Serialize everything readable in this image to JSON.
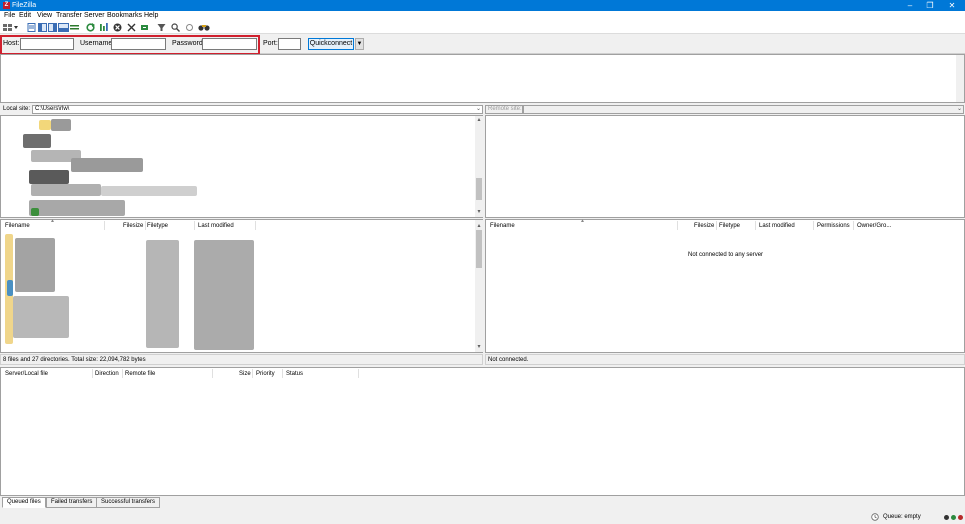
{
  "window": {
    "title": "FileZilla",
    "app_icon": "Z"
  },
  "menu": [
    "File",
    "Edit",
    "View",
    "Transfer",
    "Server",
    "Bookmarks",
    "Help"
  ],
  "quickconnect": {
    "host_label": "Host:",
    "username_label": "Username:",
    "password_label": "Password:",
    "port_label": "Port:",
    "button_label": "Quickconnect",
    "host_value": "",
    "username_value": "",
    "password_value": "",
    "port_value": ""
  },
  "local": {
    "site_label": "Local site:",
    "site_path": "C:\\Users\\rlw\\",
    "columns": [
      "Filename",
      "Filesize",
      "Filetype",
      "Last modified"
    ],
    "status": "8 files and 27 directories. Total size: 22,094,782 bytes"
  },
  "remote": {
    "site_label": "Remote site:",
    "site_path": "",
    "columns": [
      "Filename",
      "Filesize",
      "Filetype",
      "Last modified",
      "Permissions",
      "Owner/Gro..."
    ],
    "empty_message": "Not connected to any server",
    "status": "Not connected."
  },
  "queue": {
    "columns": [
      "Server/Local file",
      "Direction",
      "Remote file",
      "Size",
      "Priority",
      "Status"
    ],
    "tabs": [
      "Queued files",
      "Failed transfers",
      "Successful transfers"
    ]
  },
  "statusbar": {
    "queue_text": "Queue: empty"
  },
  "colors": {
    "titlebar": "#0078d7",
    "highlight": "#d0202e",
    "app_icon": "#bf1e2e"
  },
  "icons": [
    "site-manager-icon",
    "toggle-log-icon",
    "toggle-local-tree-icon",
    "toggle-remote-tree-icon",
    "toggle-queue-icon",
    "refresh-icon",
    "process-queue-icon",
    "cancel-icon",
    "disconnect-icon",
    "reconnect-icon",
    "filter-icon",
    "search-icon",
    "compare-icon",
    "find-files-icon"
  ]
}
